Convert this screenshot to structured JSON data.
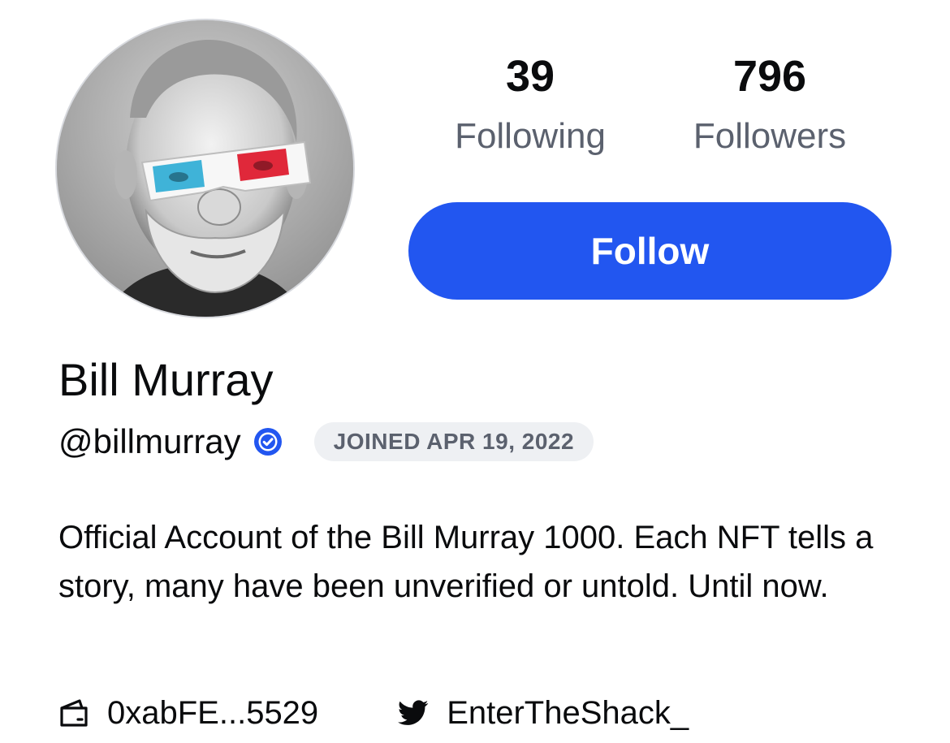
{
  "profile": {
    "name": "Bill Murray",
    "handle": "@billmurray",
    "verified_icon": "verified-badge-icon",
    "joined": "JOINED APR 19, 2022",
    "bio": "Official Account of the Bill Murray 1000. Each NFT tells a story, many have been unverified or untold. Until now.",
    "avatar": "profile-photo"
  },
  "stats": {
    "following": {
      "count": "39",
      "label": "Following"
    },
    "followers": {
      "count": "796",
      "label": "Followers"
    }
  },
  "actions": {
    "follow_label": "Follow"
  },
  "links": {
    "wallet": {
      "icon": "wallet-icon",
      "text": "0xabFE...5529"
    },
    "twitter": {
      "icon": "twitter-icon",
      "text": "EnterTheShack_"
    }
  },
  "colors": {
    "accent": "#2256f0",
    "text_primary": "#0a0b0d",
    "text_secondary": "#5b616e",
    "badge_bg": "#eef0f3"
  }
}
